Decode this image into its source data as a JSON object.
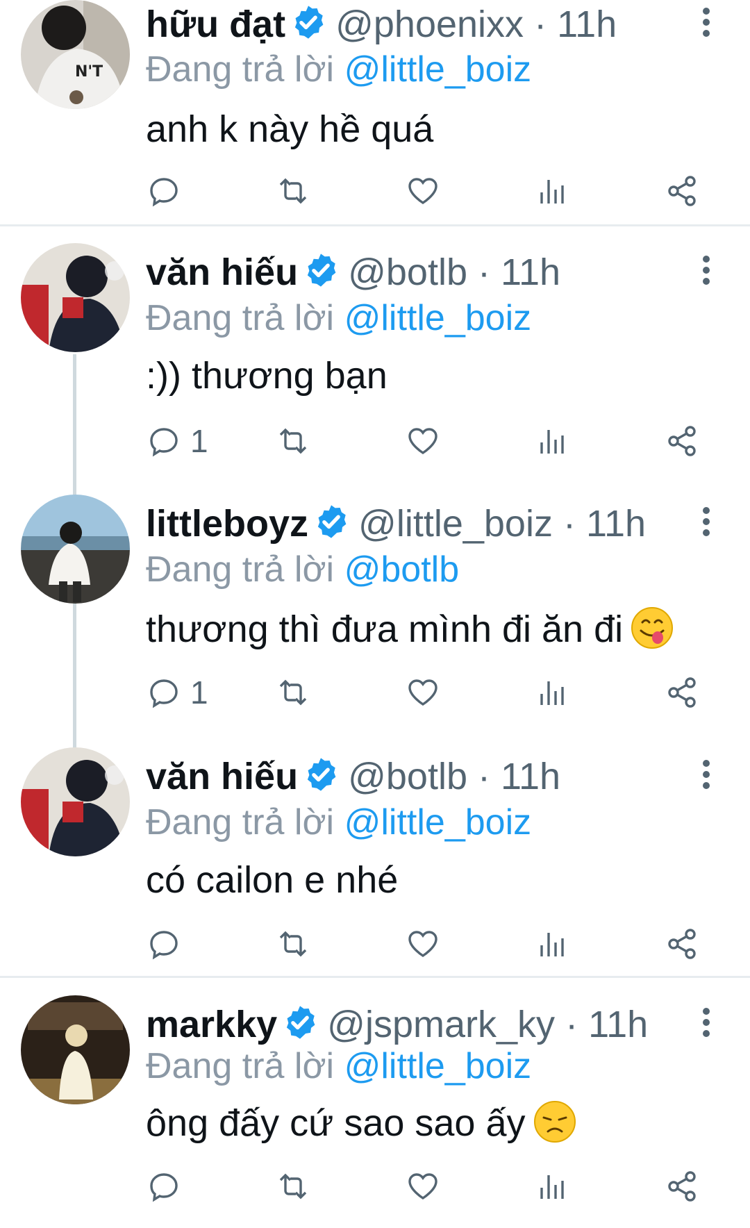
{
  "colors": {
    "text_primary": "#0f1419",
    "text_secondary": "#536471",
    "mention": "#1d9bf0",
    "verified": "#1d9bf0",
    "thread_line": "#cfd9de"
  },
  "tweets": [
    {
      "name": "hữu đạt",
      "handle": "@phoenixx",
      "separator": "·",
      "time": "11h",
      "reply_prefix": "Đang trả lời",
      "reply_to": "@little_boiz",
      "text": "anh k này hề quá",
      "reply_count": "",
      "emoji": ""
    },
    {
      "name": "văn hiếu",
      "handle": "@botlb",
      "separator": "·",
      "time": "11h",
      "reply_prefix": "Đang trả lời",
      "reply_to": "@little_boiz",
      "text": ":)) thương bạn",
      "reply_count": "1",
      "emoji": ""
    },
    {
      "name": "littleboyz",
      "handle": "@little_boiz",
      "separator": "·",
      "time": "11h",
      "reply_prefix": "Đang trả lời",
      "reply_to": "@botlb",
      "text": "thương thì đưa mình đi ăn đi",
      "reply_count": "1",
      "emoji": "yum-face-emoji"
    },
    {
      "name": "văn hiếu",
      "handle": "@botlb",
      "separator": "·",
      "time": "11h",
      "reply_prefix": "Đang trả lời",
      "reply_to": "@little_boiz",
      "text": "có cailon e nhé",
      "reply_count": "",
      "emoji": ""
    },
    {
      "name": "markky",
      "handle": "@jspmark_ky",
      "separator": "·",
      "time": "11h",
      "reply_prefix": "Đang trả lời",
      "reply_to": "@little_boiz",
      "text": "ông đấy cứ sao sao ấy",
      "reply_count": "",
      "emoji": "disappointed-face-emoji"
    }
  ]
}
